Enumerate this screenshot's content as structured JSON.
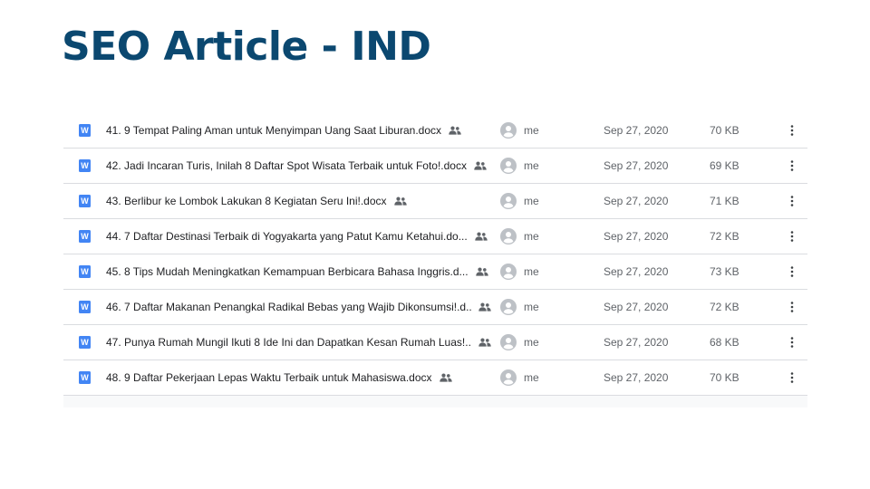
{
  "slide": {
    "title": "SEO Article - IND"
  },
  "files": [
    {
      "name": "41. 9 Tempat Paling Aman untuk Menyimpan Uang Saat Liburan.docx",
      "icon_letter": "W",
      "owner": "me",
      "modified": "Sep 27, 2020",
      "size": "70 KB"
    },
    {
      "name": "42. Jadi Incaran Turis, Inilah 8 Daftar Spot Wisata Terbaik untuk Foto!.docx",
      "icon_letter": "W",
      "owner": "me",
      "modified": "Sep 27, 2020",
      "size": "69 KB"
    },
    {
      "name": "43. Berlibur ke Lombok Lakukan 8 Kegiatan Seru Ini!.docx",
      "icon_letter": "W",
      "owner": "me",
      "modified": "Sep 27, 2020",
      "size": "71 KB"
    },
    {
      "name": "44. 7 Daftar Destinasi Terbaik di Yogyakarta yang Patut Kamu Ketahui.do...",
      "icon_letter": "W",
      "owner": "me",
      "modified": "Sep 27, 2020",
      "size": "72 KB"
    },
    {
      "name": "45. 8 Tips Mudah Meningkatkan Kemampuan Berbicara Bahasa Inggris.d...",
      "icon_letter": "W",
      "owner": "me",
      "modified": "Sep 27, 2020",
      "size": "73 KB"
    },
    {
      "name": "46. 7 Daftar Makanan Penangkal Radikal Bebas yang Wajib Dikonsumsi!.d...",
      "icon_letter": "W",
      "owner": "me",
      "modified": "Sep 27, 2020",
      "size": "72 KB"
    },
    {
      "name": "47. Punya Rumah Mungil Ikuti 8 Ide Ini dan Dapatkan Kesan Rumah Luas!....",
      "icon_letter": "W",
      "owner": "me",
      "modified": "Sep 27, 2020",
      "size": "68 KB"
    },
    {
      "name": "48. 9 Daftar Pekerjaan Lepas Waktu Terbaik untuk Mahasiswa.docx",
      "icon_letter": "W",
      "owner": "me",
      "modified": "Sep 27, 2020",
      "size": "70 KB"
    }
  ],
  "icons": {
    "file_type": "word-doc-icon",
    "shared": "people-icon",
    "owner": "avatar-icon",
    "more": "more-vert-icon"
  },
  "colors": {
    "title": "#0b4870",
    "word_icon": "#4285f4",
    "primary_text": "#202124",
    "secondary_text": "#5f6368",
    "divider": "#dadce0"
  }
}
